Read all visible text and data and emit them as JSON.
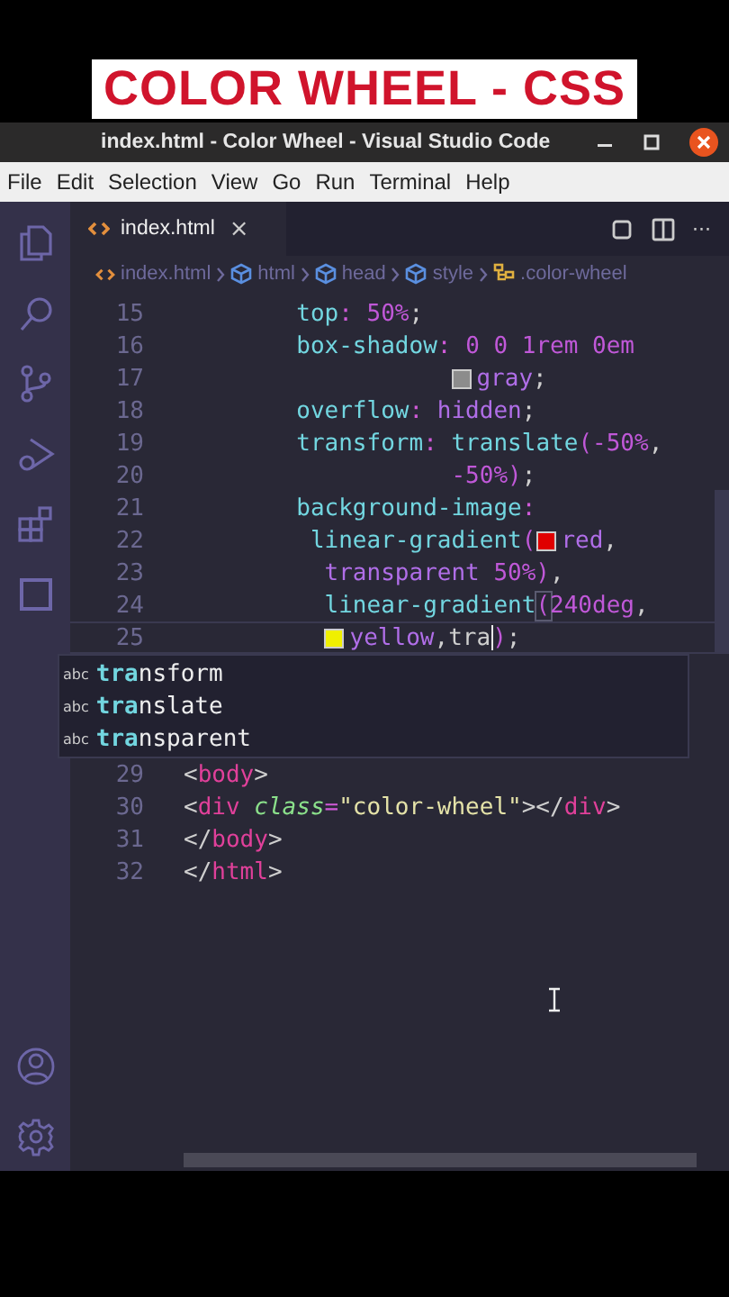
{
  "banner": {
    "title": "COLOR WHEEL - CSS"
  },
  "window": {
    "title": "index.html - Color Wheel - Visual Studio Code"
  },
  "menu": [
    "File",
    "Edit",
    "Selection",
    "View",
    "Go",
    "Run",
    "Terminal",
    "Help"
  ],
  "tabs": [
    {
      "label": "index.html",
      "selected": true,
      "close": "×"
    }
  ],
  "tab_actions": {
    "more": "···"
  },
  "breadcrumbs": [
    {
      "label": "index.html",
      "kind": "file"
    },
    {
      "label": "html",
      "kind": "element"
    },
    {
      "label": "head",
      "kind": "element"
    },
    {
      "label": "style",
      "kind": "element"
    },
    {
      "label": ".color-wheel",
      "kind": "selector"
    }
  ],
  "code_lines": [
    {
      "number": "15",
      "tokens": [
        {
          "kind": "prop",
          "text": "        top"
        },
        {
          "kind": "punct",
          "text": ": "
        },
        {
          "kind": "num",
          "text": "50%"
        },
        {
          "kind": "plain",
          "text": ";"
        }
      ]
    },
    {
      "number": "16",
      "tokens": [
        {
          "kind": "prop",
          "text": "        box-shadow"
        },
        {
          "kind": "punct",
          "text": ": "
        },
        {
          "kind": "num",
          "text": "0 0 1rem 0em"
        }
      ]
    },
    {
      "number": "17",
      "tokens": [
        {
          "kind": "value",
          "text": "                   gray",
          "color": "#8c8c8c"
        },
        {
          "kind": "plain",
          "text": ";"
        }
      ]
    },
    {
      "number": "18",
      "tokens": [
        {
          "kind": "prop",
          "text": "        overflow"
        },
        {
          "kind": "punct",
          "text": ": "
        },
        {
          "kind": "value",
          "text": "hidden"
        },
        {
          "kind": "plain",
          "text": ";"
        }
      ]
    },
    {
      "number": "19",
      "tokens": [
        {
          "kind": "prop",
          "text": "        transform"
        },
        {
          "kind": "punct",
          "text": ": "
        },
        {
          "kind": "func",
          "text": "translate"
        },
        {
          "kind": "num",
          "text": "(-50%"
        },
        {
          "kind": "plain",
          "text": ","
        }
      ]
    },
    {
      "number": "20",
      "tokens": [
        {
          "kind": "num",
          "text": "                   -50%)"
        },
        {
          "kind": "plain",
          "text": ";"
        }
      ]
    },
    {
      "number": "21",
      "tokens": [
        {
          "kind": "prop",
          "text": "        background-image"
        },
        {
          "kind": "punct",
          "text": ":"
        }
      ]
    },
    {
      "number": "22",
      "tokens": [
        {
          "kind": "func",
          "text": "         linear-gradient"
        },
        {
          "kind": "num",
          "text": "("
        },
        {
          "kind": "value",
          "text": "red",
          "color": "#e00000"
        },
        {
          "kind": "plain",
          "text": ","
        }
      ]
    },
    {
      "number": "23",
      "tokens": [
        {
          "kind": "value",
          "text": "          transparent "
        },
        {
          "kind": "num",
          "text": "50%)"
        },
        {
          "kind": "plain",
          "text": ","
        }
      ]
    },
    {
      "number": "24",
      "tokens": [
        {
          "kind": "func",
          "text": "          linear-gradient"
        },
        {
          "kind": "bracket",
          "text": "("
        },
        {
          "kind": "num",
          "text": "240deg"
        },
        {
          "kind": "plain",
          "text": ","
        }
      ]
    },
    {
      "number": "25",
      "tokens": [
        {
          "kind": "value",
          "text": "          yellow",
          "color": "#f0f000"
        },
        {
          "kind": "plain",
          "text": ",tra",
          "cursor_after": true
        },
        {
          "kind": "num",
          "text": ")"
        },
        {
          "kind": "plain",
          "text": ";"
        }
      ],
      "current": true
    },
    {
      "number": "29",
      "tokens": [
        {
          "kind": "plain",
          "text": "<"
        },
        {
          "kind": "tag",
          "text": "body"
        },
        {
          "kind": "plain",
          "text": ">"
        }
      ]
    },
    {
      "number": "30",
      "tokens": [
        {
          "kind": "plain",
          "text": "<"
        },
        {
          "kind": "tag",
          "text": "div"
        },
        {
          "kind": "attr",
          "text": " class"
        },
        {
          "kind": "punct",
          "text": "="
        },
        {
          "kind": "string",
          "text": "\"color-wheel\""
        },
        {
          "kind": "plain",
          "text": "></"
        },
        {
          "kind": "tag",
          "text": "div"
        },
        {
          "kind": "plain",
          "text": ">"
        }
      ]
    },
    {
      "number": "31",
      "tokens": [
        {
          "kind": "plain",
          "text": "</"
        },
        {
          "kind": "tag",
          "text": "body"
        },
        {
          "kind": "plain",
          "text": ">"
        }
      ]
    },
    {
      "number": "32",
      "tokens": [
        {
          "kind": "plain",
          "text": "</"
        },
        {
          "kind": "tag",
          "text": "html"
        },
        {
          "kind": "plain",
          "text": ">"
        }
      ]
    }
  ],
  "suggestions": [
    {
      "kind_label": "abc",
      "label": "**tra**nsform"
    },
    {
      "kind_label": "abc",
      "label": "**tra**nslate"
    },
    {
      "kind_label": "abc",
      "label": "**tra**nsparent"
    }
  ]
}
